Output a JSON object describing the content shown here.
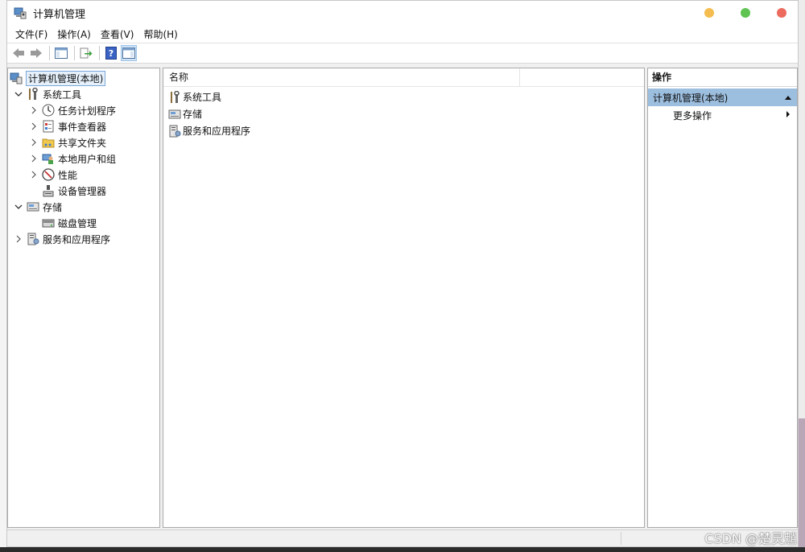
{
  "window": {
    "title": "计算机管理"
  },
  "menu": [
    "文件(F)",
    "操作(A)",
    "查看(V)",
    "帮助(H)"
  ],
  "toolbar": {
    "buttons": [
      "back-arrow-icon",
      "forward-arrow-icon",
      "show-hide-tree-icon",
      "export-list-icon",
      "help-icon",
      "show-hide-action-pane-icon"
    ]
  },
  "tree": {
    "root": "计算机管理(本地)",
    "system_tools": "系统工具",
    "task_scheduler": "任务计划程序",
    "event_viewer": "事件查看器",
    "shared_folders": "共享文件夹",
    "local_users": "本地用户和组",
    "performance": "性能",
    "device_manager": "设备管理器",
    "storage": "存储",
    "disk_management": "磁盘管理",
    "services_apps": "服务和应用程序"
  },
  "list": {
    "column_name": "名称",
    "items": [
      "系统工具",
      "存储",
      "服务和应用程序"
    ]
  },
  "actions": {
    "header": "操作",
    "section": "计算机管理(本地)",
    "more": "更多操作"
  },
  "watermark": "CSDN @楚灵魈"
}
